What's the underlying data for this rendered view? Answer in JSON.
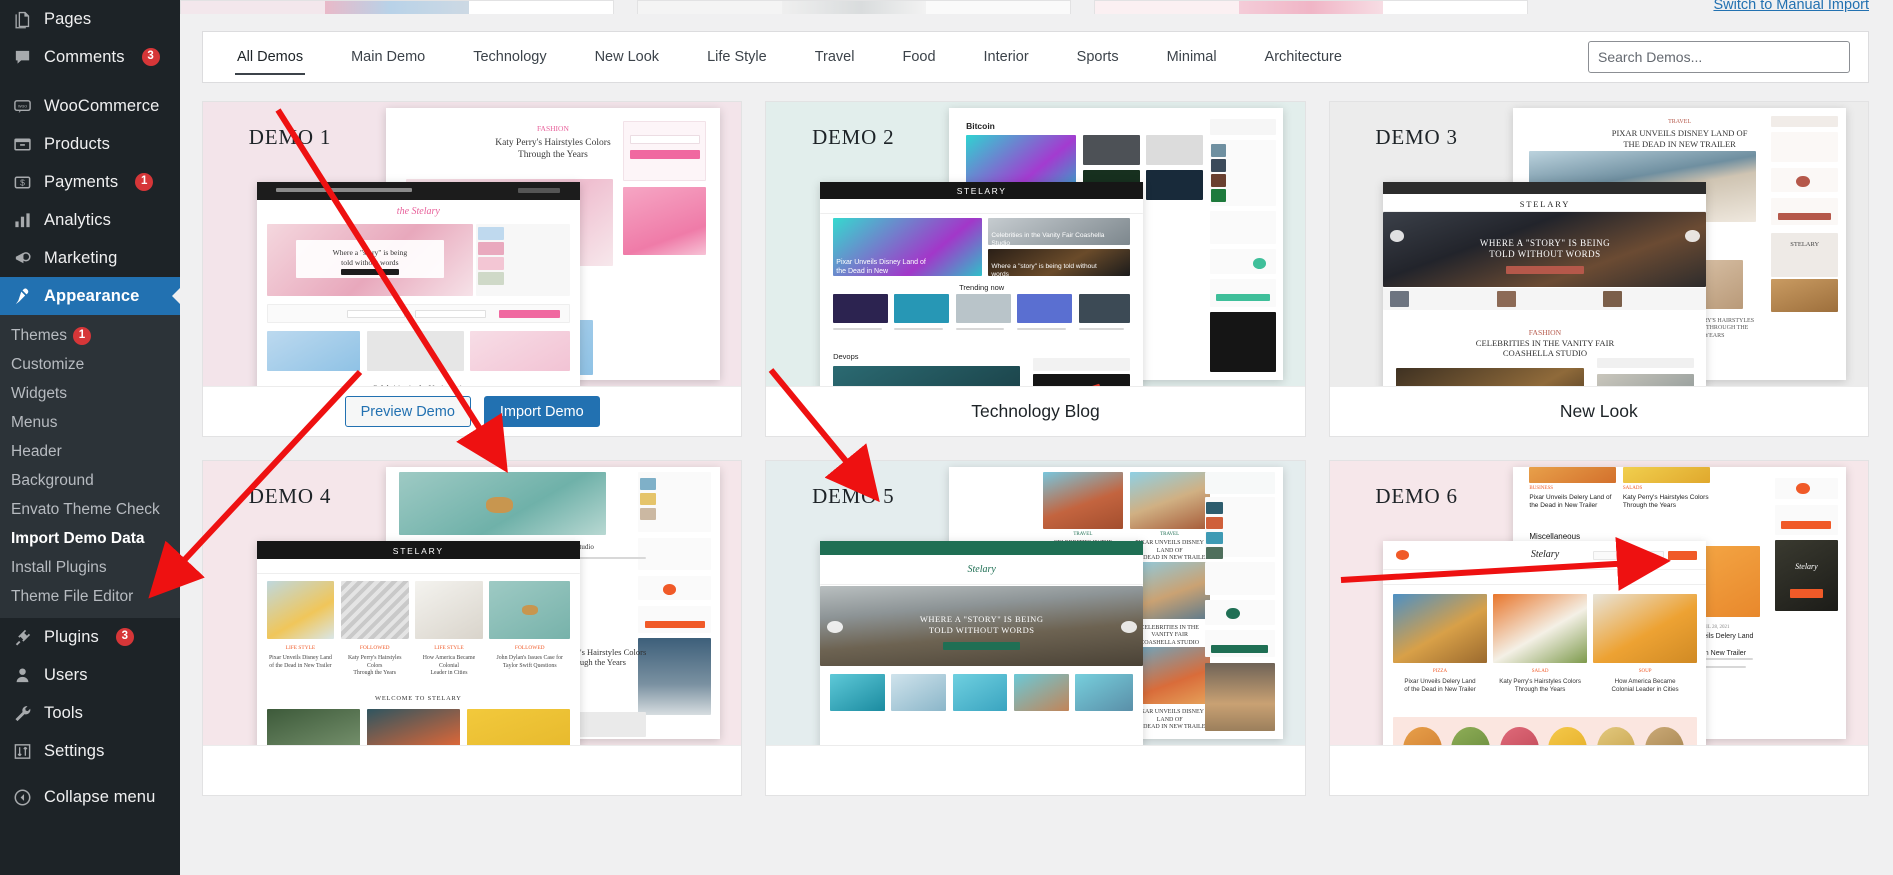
{
  "sidebar": {
    "items": [
      {
        "label": "Pages",
        "icon": "pages-icon",
        "badge": null
      },
      {
        "label": "Comments",
        "icon": "comments-icon",
        "badge": "3"
      },
      {
        "label": "WooCommerce",
        "icon": "woocommerce-icon",
        "badge": null
      },
      {
        "label": "Products",
        "icon": "products-icon",
        "badge": null
      },
      {
        "label": "Payments",
        "icon": "payments-icon",
        "badge": "1"
      },
      {
        "label": "Analytics",
        "icon": "analytics-icon",
        "badge": null
      },
      {
        "label": "Marketing",
        "icon": "marketing-icon",
        "badge": null
      },
      {
        "label": "Appearance",
        "icon": "appearance-icon",
        "badge": null
      },
      {
        "label": "Plugins",
        "icon": "plugins-icon",
        "badge": "3"
      },
      {
        "label": "Users",
        "icon": "users-icon",
        "badge": null
      },
      {
        "label": "Tools",
        "icon": "tools-icon",
        "badge": null
      },
      {
        "label": "Settings",
        "icon": "settings-icon",
        "badge": null
      },
      {
        "label": "Collapse menu",
        "icon": "collapse-icon",
        "badge": null
      }
    ],
    "appearance_submenu": [
      {
        "label": "Themes",
        "badge": "1",
        "current": false
      },
      {
        "label": "Customize",
        "badge": null,
        "current": false
      },
      {
        "label": "Widgets",
        "badge": null,
        "current": false
      },
      {
        "label": "Menus",
        "badge": null,
        "current": false
      },
      {
        "label": "Header",
        "badge": null,
        "current": false
      },
      {
        "label": "Background",
        "badge": null,
        "current": false
      },
      {
        "label": "Envato Theme Check",
        "badge": null,
        "current": false
      },
      {
        "label": "Import Demo Data",
        "badge": null,
        "current": true
      },
      {
        "label": "Install Plugins",
        "badge": null,
        "current": false
      },
      {
        "label": "Theme File Editor",
        "badge": null,
        "current": false
      }
    ]
  },
  "header": {
    "manual_import_link": "Switch to Manual Import"
  },
  "tabs": [
    {
      "label": "All Demos",
      "active": true
    },
    {
      "label": "Main Demo",
      "active": false
    },
    {
      "label": "Technology",
      "active": false
    },
    {
      "label": "New Look",
      "active": false
    },
    {
      "label": "Life Style",
      "active": false
    },
    {
      "label": "Travel",
      "active": false
    },
    {
      "label": "Food",
      "active": false
    },
    {
      "label": "Interior",
      "active": false
    },
    {
      "label": "Sports",
      "active": false
    },
    {
      "label": "Minimal",
      "active": false
    },
    {
      "label": "Architecture",
      "active": false
    }
  ],
  "search": {
    "placeholder": "Search Demos...",
    "value": ""
  },
  "buttons": {
    "preview_demo": "Preview Demo",
    "import_demo": "Import Demo"
  },
  "demos": [
    {
      "label": "DEMO 1",
      "title": "",
      "hovered": true,
      "bg": "#f3e4ea",
      "accent": "#e8609a"
    },
    {
      "label": "DEMO 2",
      "title": "Technology Blog",
      "hovered": false,
      "bg": "#e2eeec",
      "accent": "#3fbf9a"
    },
    {
      "label": "DEMO 3",
      "title": "New Look",
      "hovered": false,
      "bg": "#ececec",
      "accent": "#b5584a"
    },
    {
      "label": "DEMO 4",
      "title": "",
      "hovered": false,
      "bg": "#f5e6ea",
      "accent": "#f05a28"
    },
    {
      "label": "DEMO 5",
      "title": "",
      "hovered": false,
      "bg": "#e4edee",
      "accent": "#1f6f54"
    },
    {
      "label": "DEMO 6",
      "title": "",
      "hovered": false,
      "bg": "#f6e7ea",
      "accent": "#f05a28"
    }
  ],
  "colors": {
    "wp_blue": "#2271b1",
    "sidebar_bg": "#1d2327",
    "submenu_bg": "#2c3338",
    "badge_red": "#d63638",
    "annotation_red": "#ee1111",
    "page_bg": "#f0f0f1"
  }
}
